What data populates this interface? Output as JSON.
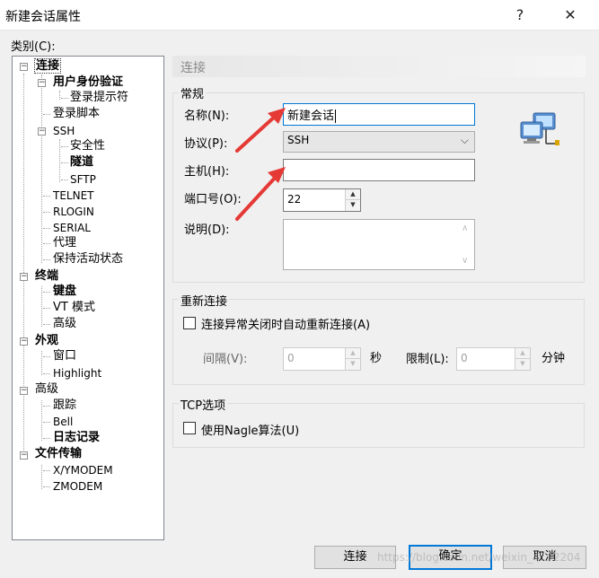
{
  "window": {
    "title": "新建会话属性",
    "help_glyph": "?",
    "close_glyph": "✕"
  },
  "category_label": "类别(C):",
  "tree": {
    "connection": "连接",
    "auth": "用户身份验证",
    "login_prompt": "登录提示符",
    "login_script": "登录脚本",
    "ssh": "SSH",
    "security": "安全性",
    "tunnel": "隧道",
    "sftp": "SFTP",
    "telnet": "TELNET",
    "rlogin": "RLOGIN",
    "serial": "SERIAL",
    "proxy": "代理",
    "keepalive": "保持活动状态",
    "terminal": "终端",
    "keyboard": "键盘",
    "vt_mode": "VT 模式",
    "advanced": "高级",
    "appearance": "外观",
    "window": "窗口",
    "highlight": "Highlight",
    "advanced2": "高级",
    "trace": "跟踪",
    "bell": "Bell",
    "logging": "日志记录",
    "file_transfer": "文件传输",
    "xymodem": "X/YMODEM",
    "zmodem": "ZMODEM"
  },
  "panel": {
    "header": "连接",
    "general": {
      "legend": "常规",
      "name_label": "名称(N):",
      "name_value": "新建会话",
      "protocol_label": "协议(P):",
      "protocol_value": "SSH",
      "host_label": "主机(H):",
      "host_value": "",
      "port_label": "端口号(O):",
      "port_value": "22",
      "desc_label": "说明(D):"
    },
    "reconnect": {
      "legend": "重新连接",
      "checkbox_label": "连接异常关闭时自动重新连接(A)",
      "interval_label": "间隔(V):",
      "interval_value": "0",
      "seconds_unit": "秒",
      "limit_label": "限制(L):",
      "limit_value": "0",
      "minutes_unit": "分钟"
    },
    "tcp": {
      "legend": "TCP选项",
      "nagle_label": "使用Nagle算法(U)"
    }
  },
  "buttons": {
    "connect": "连接",
    "ok": "确定",
    "cancel": "取消"
  },
  "watermark": "https://blog.csdn.net/weixin_4... 2204",
  "colors": {
    "accent": "#0078d7",
    "arrow": "#e53935"
  }
}
